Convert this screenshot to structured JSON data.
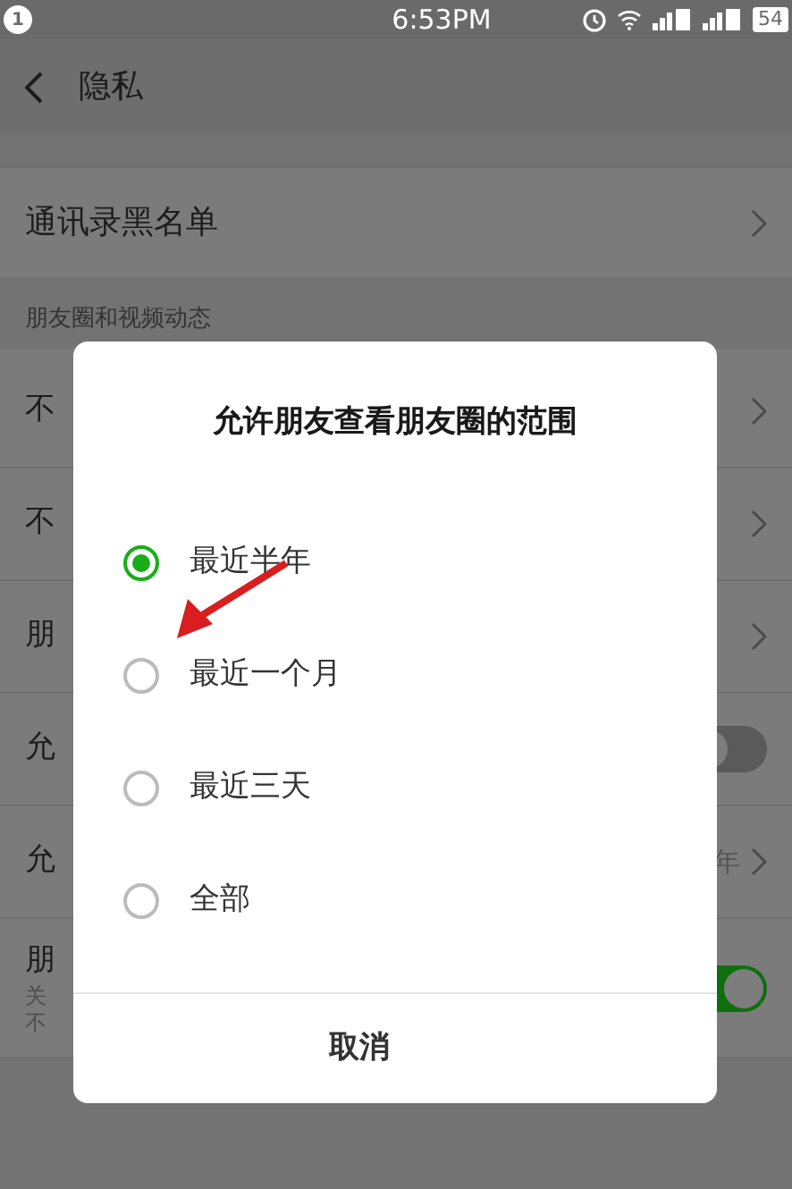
{
  "status_bar": {
    "notification_count": "1",
    "time": "6:53PM",
    "battery": "54"
  },
  "nav": {
    "title": "隐私"
  },
  "top_rows": [
    {
      "label": "通讯录黑名单"
    }
  ],
  "section_header": "朋友圈和视频动态",
  "rows": [
    {
      "kind": "link",
      "label": "不"
    },
    {
      "kind": "link",
      "label": "不"
    },
    {
      "kind": "link",
      "label": "朋"
    },
    {
      "kind": "toggle",
      "label": "允",
      "on": false
    },
    {
      "kind": "link",
      "label": "允",
      "value": "年"
    },
    {
      "kind": "toggle",
      "label": "朋",
      "on": true,
      "note": [
        "关",
        "不"
      ]
    }
  ],
  "dialog": {
    "title": "允许朋友查看朋友圈的范围",
    "options": [
      {
        "label": "最近半年",
        "selected": true
      },
      {
        "label": "最近一个月",
        "selected": false
      },
      {
        "label": "最近三天",
        "selected": false
      },
      {
        "label": "全部",
        "selected": false
      }
    ],
    "cancel": "取消"
  }
}
